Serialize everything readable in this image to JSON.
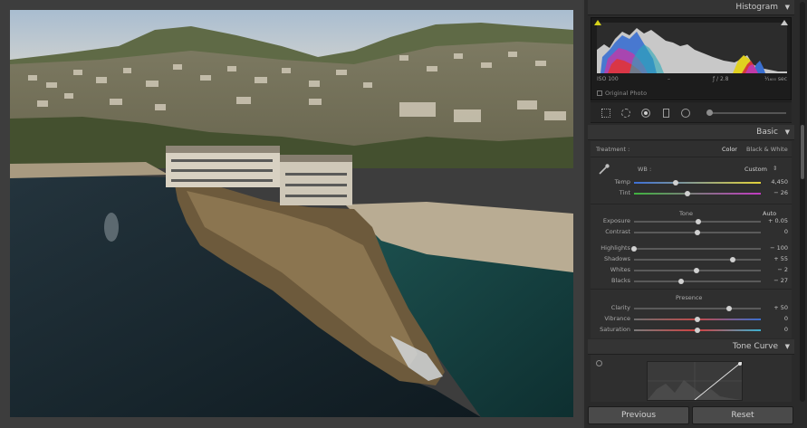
{
  "histogram": {
    "title": "Histogram",
    "iso": "ISO 100",
    "focal": "–",
    "aperture": "ƒ / 2.8",
    "shutter": "¹⁄₁₆₀₀ sec",
    "original_photo": "Original Photo"
  },
  "basic": {
    "title": "Basic",
    "treatment_label": "Treatment :",
    "color": "Color",
    "bw": "Black & White",
    "wb_label": "WB :",
    "wb_value": "Custom",
    "tone_label": "Tone",
    "auto": "Auto",
    "presence_label": "Presence",
    "sliders": [
      {
        "key": "temp",
        "label": "Temp",
        "value": "4,450",
        "pos": 0.33,
        "kind": "temp"
      },
      {
        "key": "tint",
        "label": "Tint",
        "value": "− 26",
        "pos": 0.42,
        "kind": "tint"
      },
      {
        "key": "exposure",
        "label": "Exposure",
        "value": "+ 0.05",
        "pos": 0.51,
        "kind": "plain"
      },
      {
        "key": "contrast",
        "label": "Contrast",
        "value": "0",
        "pos": 0.5,
        "kind": "plain"
      },
      {
        "key": "highlights",
        "label": "Highlights",
        "value": "− 100",
        "pos": 0.0,
        "kind": "plain"
      },
      {
        "key": "shadows",
        "label": "Shadows",
        "value": "+ 55",
        "pos": 0.78,
        "kind": "plain"
      },
      {
        "key": "whites",
        "label": "Whites",
        "value": "− 2",
        "pos": 0.49,
        "kind": "plain"
      },
      {
        "key": "blacks",
        "label": "Blacks",
        "value": "− 27",
        "pos": 0.37,
        "kind": "plain"
      },
      {
        "key": "clarity",
        "label": "Clarity",
        "value": "+ 50",
        "pos": 0.75,
        "kind": "plain"
      },
      {
        "key": "vibrance",
        "label": "Vibrance",
        "value": "0",
        "pos": 0.5,
        "kind": "vib"
      },
      {
        "key": "saturation",
        "label": "Saturation",
        "value": "0",
        "pos": 0.5,
        "kind": "sat"
      }
    ]
  },
  "tone_curve": {
    "title": "Tone Curve"
  },
  "buttons": {
    "previous": "Previous",
    "reset": "Reset"
  },
  "colors": {
    "panel": "#2a2a2a",
    "accent": "#d6d21a"
  }
}
